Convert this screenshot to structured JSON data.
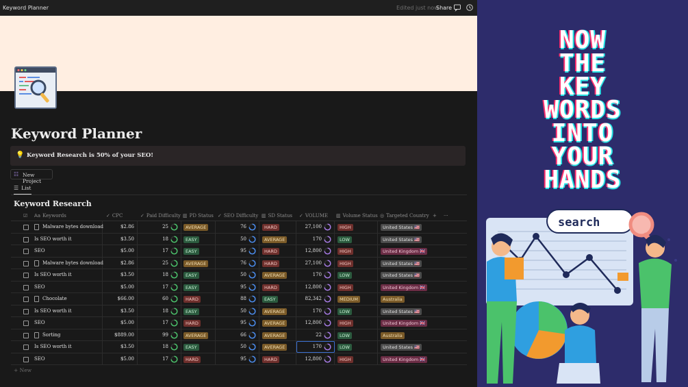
{
  "topbar": {
    "title": "Keyword Planner",
    "edited": "Edited just now",
    "share": "Share"
  },
  "page": {
    "title": "Keyword Planner",
    "callout": "Keyword Research is 50% of your SEO!",
    "new_project": "New Project",
    "view_tab": "List",
    "database_title": "Keyword Research",
    "new_row": "+ New"
  },
  "columns": [
    {
      "key": "keywords",
      "label": "Keywords",
      "icon": "Aa"
    },
    {
      "key": "cpc",
      "label": "CPC",
      "icon": "✓"
    },
    {
      "key": "paid",
      "label": "Paid Difficulty",
      "icon": "✓"
    },
    {
      "key": "pd_status",
      "label": "PD Status",
      "icon": "▤"
    },
    {
      "key": "seo",
      "label": "SEO Difficulty",
      "icon": "✓"
    },
    {
      "key": "sd_status",
      "label": "SD Status",
      "icon": "▤"
    },
    {
      "key": "volume",
      "label": "VOLUME",
      "icon": "✓"
    },
    {
      "key": "vol_status",
      "label": "Volume Status",
      "icon": "▤"
    },
    {
      "key": "country",
      "label": "Targeted Country",
      "icon": "◎"
    }
  ],
  "rows": [
    {
      "keyword": "Malware bytes download",
      "doc": true,
      "cpc": "$2.86",
      "paid": "25",
      "pd": "AVERAGE",
      "seo": "76",
      "sd": "HARD",
      "volume": "27,100",
      "vs": "HIGH",
      "country": "United States 🇺🇸"
    },
    {
      "keyword": "Is SEO worth it",
      "doc": false,
      "cpc": "$3.50",
      "paid": "18",
      "pd": "EASY",
      "seo": "50",
      "sd": "AVERAGE",
      "volume": "170",
      "vs": "LOW",
      "country": "United States 🇺🇸"
    },
    {
      "keyword": "SEO",
      "doc": false,
      "cpc": "$5.00",
      "paid": "17",
      "pd": "EASY",
      "seo": "95",
      "sd": "HARD",
      "volume": "12,800",
      "vs": "HIGH",
      "country": "United Kingdom 🇬🇧"
    },
    {
      "keyword": "Malware bytes download",
      "doc": true,
      "cpc": "$2.86",
      "paid": "25",
      "pd": "AVERAGE",
      "seo": "76",
      "sd": "HARD",
      "volume": "27,100",
      "vs": "HIGH",
      "country": "United States 🇺🇸"
    },
    {
      "keyword": "Is SEO worth it",
      "doc": false,
      "cpc": "$3.50",
      "paid": "18",
      "pd": "EASY",
      "seo": "50",
      "sd": "AVERAGE",
      "volume": "170",
      "vs": "LOW",
      "country": "United States 🇺🇸"
    },
    {
      "keyword": "SEO",
      "doc": false,
      "cpc": "$5.00",
      "paid": "17",
      "pd": "EASY",
      "seo": "95",
      "sd": "HARD",
      "volume": "12,800",
      "vs": "HIGH",
      "country": "United Kingdom 🇬🇧"
    },
    {
      "keyword": "Chocolate",
      "doc": true,
      "cpc": "$66.00",
      "paid": "60",
      "pd": "HARD",
      "seo": "88",
      "sd": "EASY",
      "volume": "82,342",
      "vs": "MEDIUM",
      "country": "Australia"
    },
    {
      "keyword": "Is SEO worth it",
      "doc": false,
      "cpc": "$3.50",
      "paid": "18",
      "pd": "EASY",
      "seo": "50",
      "sd": "AVERAGE",
      "volume": "170",
      "vs": "LOW",
      "country": "United States 🇺🇸"
    },
    {
      "keyword": "SEO",
      "doc": false,
      "cpc": "$5.00",
      "paid": "17",
      "pd": "HARD",
      "seo": "95",
      "sd": "AVERAGE",
      "volume": "12,800",
      "vs": "HIGH",
      "country": "United Kingdom 🇬🇧"
    },
    {
      "keyword": "Sorting",
      "doc": true,
      "cpc": "$889.00",
      "paid": "99",
      "pd": "AVERAGE",
      "seo": "66",
      "sd": "AVERAGE",
      "volume": "22",
      "vs": "LOW",
      "country": "Australia"
    },
    {
      "keyword": "Is SEO worth it",
      "doc": false,
      "cpc": "$3.50",
      "paid": "18",
      "pd": "EASY",
      "seo": "50",
      "sd": "AVERAGE",
      "volume": "170",
      "vs": "LOW",
      "country": "United States 🇺🇸"
    },
    {
      "keyword": "SEO",
      "doc": false,
      "cpc": "$5.00",
      "paid": "17",
      "pd": "HARD",
      "seo": "95",
      "sd": "HARD",
      "volume": "12,800",
      "vs": "HIGH",
      "country": "United Kingdom 🇬🇧"
    }
  ],
  "promo": {
    "headline": [
      "NOW",
      "THE",
      "KEY",
      "WORDS",
      "INTO",
      "YOUR",
      "HANDS"
    ],
    "search_label": "search"
  },
  "colors": {
    "background": "#191919",
    "cover": "#ffeee1",
    "promo_bg": "#2d2c6b",
    "accent_ring": "#4a8df0",
    "easy": "#2b5a3e",
    "hard": "#6e2f2c",
    "average": "#7a5a28"
  }
}
